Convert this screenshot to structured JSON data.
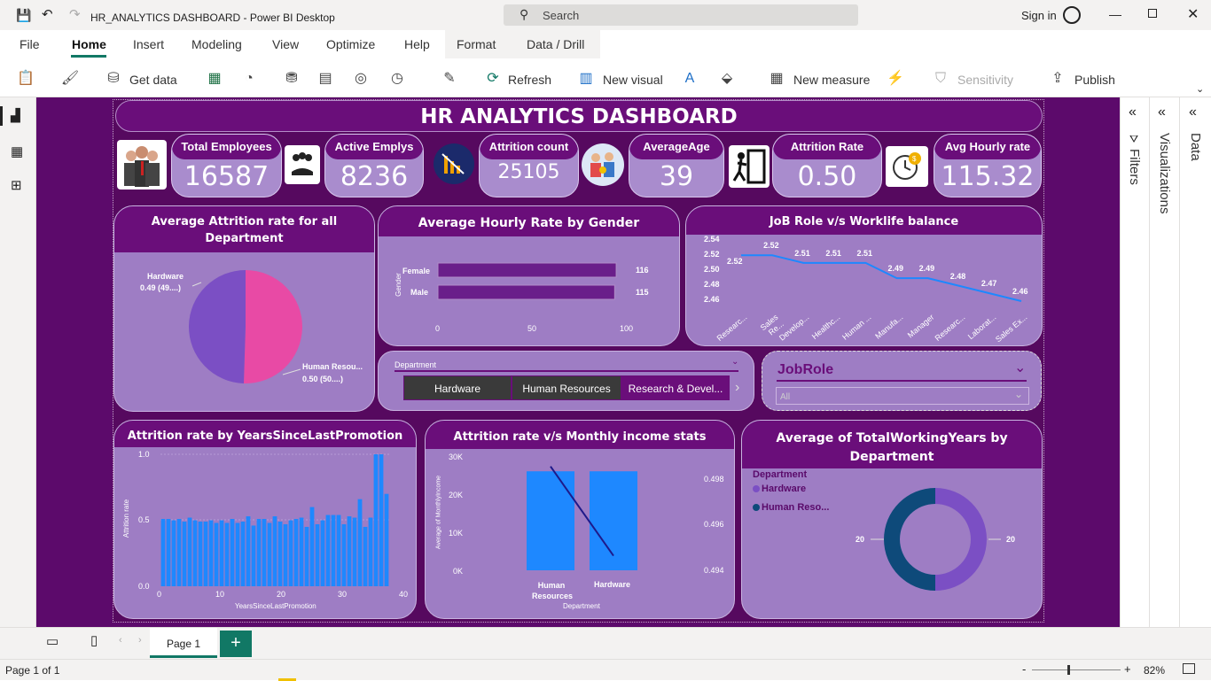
{
  "window": {
    "title": "HR_ANALYTICS DASHBOARD - Power BI Desktop",
    "search_placeholder": "Search",
    "sign_in": "Sign in"
  },
  "menu": [
    "File",
    "Home",
    "Insert",
    "Modeling",
    "View",
    "Optimize",
    "Help",
    "Format",
    "Data / Drill"
  ],
  "toolbar": {
    "get_data": "Get data",
    "refresh": "Refresh",
    "new_visual": "New visual",
    "new_measure": "New measure",
    "sensitivity": "Sensitivity",
    "publish": "Publish"
  },
  "panes": {
    "filters": "Filters",
    "visualizations": "Visualizations",
    "data": "Data"
  },
  "dashboard": {
    "title": "HR ANALYTICS DASHBOARD",
    "kpis": [
      {
        "label": "Total Employees",
        "value": "16587"
      },
      {
        "label": "Active Emplys",
        "value": "8236"
      },
      {
        "label": "Attrition count",
        "value": "25105"
      },
      {
        "label": "AverageAge",
        "value": "39"
      },
      {
        "label": "Attrition Rate",
        "value": "0.50"
      },
      {
        "label": "Avg Hourly rate",
        "value": "115.32"
      }
    ],
    "pie": {
      "title": "Average Attrition rate for all Department",
      "label1": "Hardware",
      "value1": "0.49 (49....)",
      "label2": "Human Resou...",
      "value2": "0.50 (50....)"
    },
    "gender": {
      "title": "Average Hourly Rate by Gender",
      "axis_label": "Gender",
      "rows": [
        {
          "label": "Female",
          "value": "116"
        },
        {
          "label": "Male",
          "value": "115"
        }
      ],
      "ticks": [
        "0",
        "50",
        "100"
      ]
    },
    "jobrole": {
      "title": "JoB Role v/s Worklife balance",
      "yticks": [
        "2.54",
        "2.52",
        "2.50",
        "2.48",
        "2.46"
      ],
      "cats": [
        "Researc...",
        "Sales Re...",
        "Develop...",
        "Healthc...",
        "Human ...",
        "Manufa...",
        "Manager",
        "Researc...",
        "Laborat...",
        "Sales Ex..."
      ],
      "labels": [
        "2.52",
        "2.52",
        "2.51",
        "2.51",
        "2.51",
        "2.49",
        "2.49",
        "2.48",
        "2.47",
        "2.46"
      ]
    },
    "dept_slicer": {
      "title": "Department",
      "options": [
        "Hardware",
        "Human Resources",
        "Research & Devel..."
      ]
    },
    "jobrole_slicer": {
      "title": "JobRole",
      "value": "All"
    },
    "promo": {
      "title": "Attrition rate by YearsSinceLastPromotion",
      "ylabel": "Attrition rate",
      "xlabel": "YearsSinceLastPromotion",
      "yticks": [
        "1.0",
        "0.5",
        "0.0"
      ],
      "xticks": [
        "0",
        "10",
        "20",
        "30",
        "40"
      ]
    },
    "income": {
      "title": "Attrition rate v/s Monthly income stats",
      "ylabel": "Average of MonthlyIncome",
      "xlabel": "Department",
      "yticks": [
        "30K",
        "20K",
        "10K",
        "0K"
      ],
      "y2ticks": [
        "0.498",
        "0.496",
        "0.494"
      ],
      "cat1": "Human Resources",
      "cat2": "Hardware"
    },
    "donut": {
      "title": "Average of TotalWorkingYears by Department",
      "legend_title": "Department",
      "legend1": "Hardware",
      "legend2": "Human Reso...",
      "label_left": "20",
      "label_right": "20"
    }
  },
  "pagebar": {
    "page": "Page 1"
  },
  "status": {
    "page_info": "Page 1 of 1",
    "zoom": "82%"
  },
  "colors": {
    "accent": "#6a0e7a",
    "panel": "#9e7dc4",
    "canvas": "#5c0a6b",
    "bar": "#1e88ff",
    "pie1": "#e84aa5",
    "pie2": "#7b4fc4"
  },
  "chart_data": [
    {
      "type": "pie",
      "title": "Average Attrition rate for all Department",
      "categories": [
        "Hardware",
        "Human Resources"
      ],
      "values": [
        0.49,
        0.5
      ]
    },
    {
      "type": "bar",
      "title": "Average Hourly Rate by Gender",
      "categories": [
        "Female",
        "Male"
      ],
      "values": [
        116,
        115
      ],
      "xlim": [
        0,
        120
      ]
    },
    {
      "type": "line",
      "title": "JoB Role v/s Worklife balance",
      "categories": [
        "Researc...",
        "Sales Re...",
        "Develop...",
        "Healthc...",
        "Human ...",
        "Manufa...",
        "Manager",
        "Researc...",
        "Laborat...",
        "Sales Ex..."
      ],
      "values": [
        2.52,
        2.52,
        2.51,
        2.51,
        2.51,
        2.49,
        2.49,
        2.48,
        2.47,
        2.46
      ],
      "ylim": [
        2.46,
        2.54
      ]
    },
    {
      "type": "bar",
      "title": "Attrition rate by YearsSinceLastPromotion",
      "xlabel": "YearsSinceLastPromotion",
      "ylabel": "Attrition rate",
      "ylim": [
        0,
        1
      ],
      "values": [
        0.51,
        0.51,
        0.5,
        0.51,
        0.49,
        0.52,
        0.5,
        0.49,
        0.49,
        0.5,
        0.48,
        0.5,
        0.48,
        0.51,
        0.48,
        0.49,
        0.53,
        0.46,
        0.51,
        0.51,
        0.48,
        0.53,
        0.49,
        0.47,
        0.5,
        0.51,
        0.52,
        0.45,
        0.6,
        0.47,
        0.5,
        0.54,
        0.54,
        0.54,
        0.47,
        0.53,
        0.52,
        0.66,
        0.45,
        0.52,
        1.0,
        1.0,
        0.7
      ]
    },
    {
      "type": "bar",
      "title": "Attrition rate v/s Monthly income stats",
      "categories": [
        "Human Resources",
        "Hardware"
      ],
      "values": [
        26000,
        26000
      ],
      "ylim": [
        0,
        30000
      ],
      "series_line": [
        0.4985,
        0.4942
      ]
    },
    {
      "type": "pie",
      "title": "Average of TotalWorkingYears by Department",
      "categories": [
        "Hardware",
        "Human Reso..."
      ],
      "values": [
        20,
        20
      ]
    }
  ]
}
